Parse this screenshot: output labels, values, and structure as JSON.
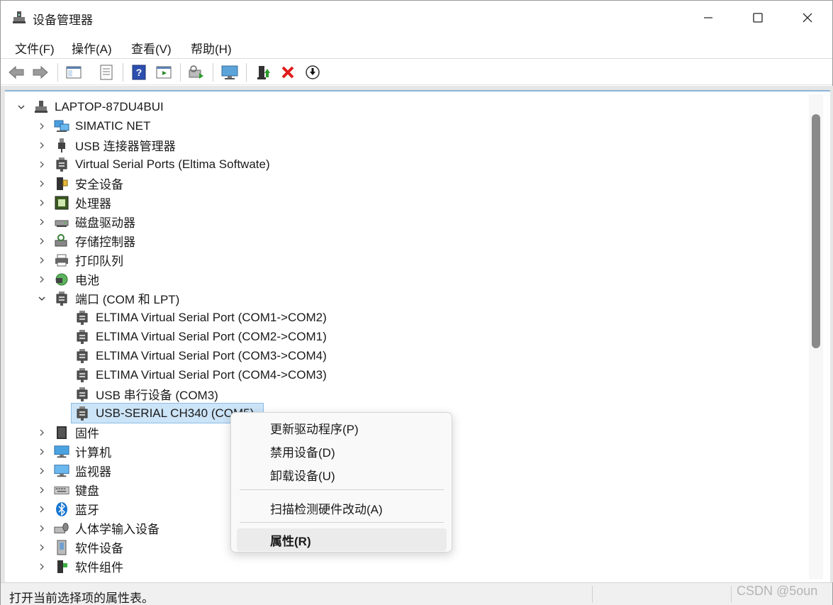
{
  "window": {
    "title": "设备管理器"
  },
  "menu": [
    "文件(F)",
    "操作(A)",
    "查看(V)",
    "帮助(H)"
  ],
  "toolbar": [
    {
      "name": "back-arrow-icon"
    },
    {
      "name": "forward-arrow-icon"
    },
    {
      "name": "show-hide-console-tree-icon"
    },
    {
      "name": "properties-icon"
    },
    {
      "name": "help-icon"
    },
    {
      "name": "action-pane-icon"
    },
    {
      "name": "scan-hardware-icon"
    },
    {
      "name": "monitor-icon"
    },
    {
      "name": "update-driver-icon"
    },
    {
      "name": "uninstall-icon"
    },
    {
      "name": "disable-device-icon"
    }
  ],
  "tree": {
    "root": "LAPTOP-87DU4BUI",
    "categories_top": [
      {
        "label": "SIMATIC NET",
        "icon": "network-icon"
      },
      {
        "label": "USB 连接器管理器",
        "icon": "usb-icon"
      },
      {
        "label": "Virtual Serial Ports (Eltima Softwate)",
        "icon": "port-icon"
      },
      {
        "label": "安全设备",
        "icon": "security-device-icon"
      },
      {
        "label": "处理器",
        "icon": "processor-icon"
      },
      {
        "label": "磁盘驱动器",
        "icon": "disk-drive-icon"
      },
      {
        "label": "存储控制器",
        "icon": "storage-controller-icon"
      },
      {
        "label": "打印队列",
        "icon": "printer-icon"
      },
      {
        "label": "电池",
        "icon": "battery-icon"
      }
    ],
    "ports": {
      "label": "端口 (COM 和 LPT)",
      "children": [
        "ELTIMA Virtual Serial Port (COM1->COM2)",
        "ELTIMA Virtual Serial Port (COM2->COM1)",
        "ELTIMA Virtual Serial Port (COM3->COM4)",
        "ELTIMA Virtual Serial Port (COM4->COM3)",
        "USB 串行设备 (COM3)",
        "USB-SERIAL CH340 (COM5)"
      ]
    },
    "categories_bottom": [
      {
        "label": "固件",
        "icon": "firmware-icon"
      },
      {
        "label": "计算机",
        "icon": "computer-icon"
      },
      {
        "label": "监视器",
        "icon": "monitor-icon"
      },
      {
        "label": "键盘",
        "icon": "keyboard-icon"
      },
      {
        "label": "蓝牙",
        "icon": "bluetooth-icon"
      },
      {
        "label": "人体学输入设备",
        "icon": "hid-icon"
      },
      {
        "label": "软件设备",
        "icon": "software-device-icon"
      },
      {
        "label": "软件组件",
        "icon": "software-component-icon"
      }
    ]
  },
  "context_menu": {
    "update_driver": "更新驱动程序(P)",
    "disable": "禁用设备(D)",
    "uninstall": "卸载设备(U)",
    "scan": "扫描检测硬件改动(A)",
    "properties": "属性(R)"
  },
  "status": {
    "text": "打开当前选择项的属性表。"
  },
  "watermark": "CSDN @5oun"
}
